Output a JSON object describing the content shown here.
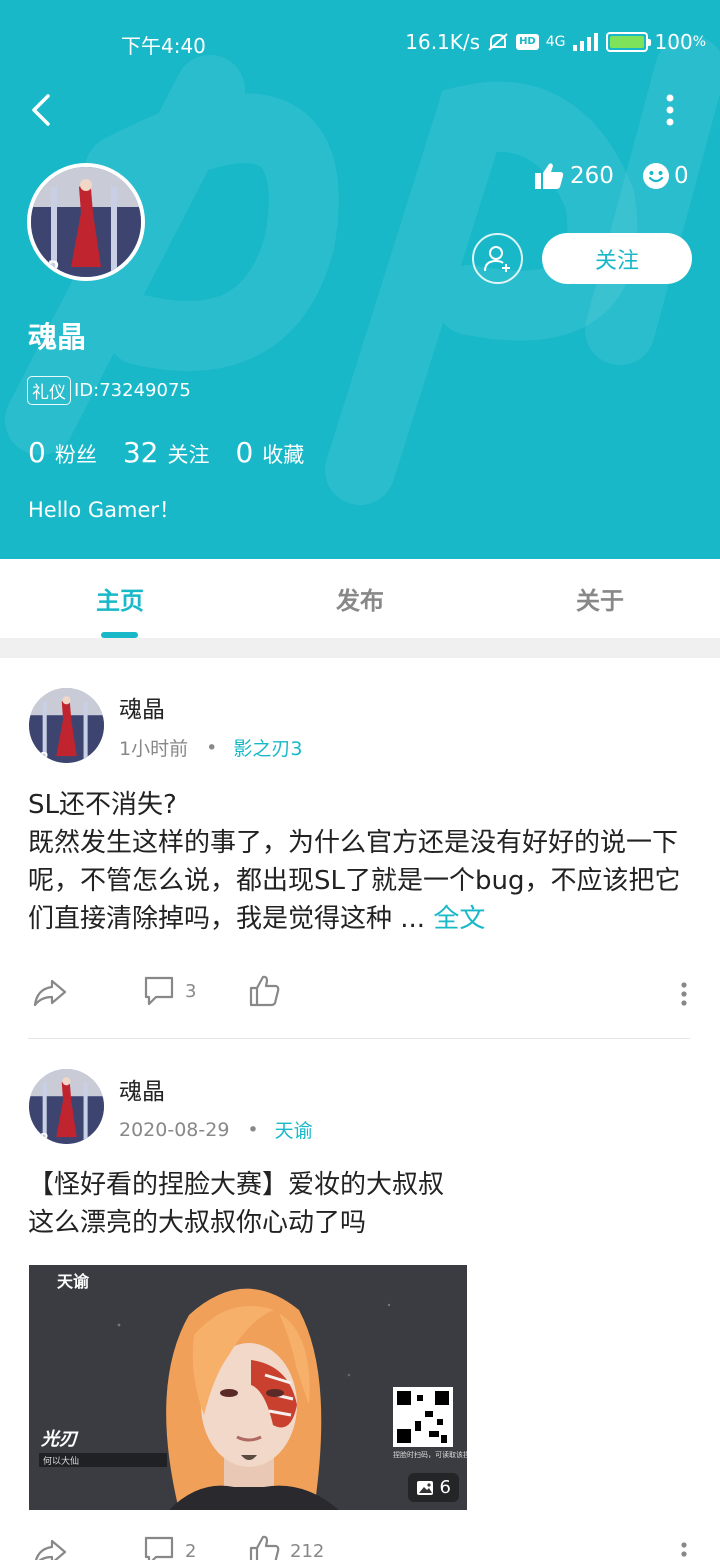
{
  "status_bar": {
    "time": "下午4:40",
    "network_speed": "16.1K/s",
    "hd": "HD",
    "signal": "4G",
    "battery": "100",
    "battery_unit": "%"
  },
  "profile": {
    "username": "魂晶",
    "badge": "礼仪",
    "id": "ID:73249075",
    "likes": "260",
    "smiles": "0",
    "follow_label": "关注",
    "fans_count": "0",
    "fans_label": "粉丝",
    "following_count": "32",
    "following_label": "关注",
    "favorites_count": "0",
    "favorites_label": "收藏",
    "bio": "Hello Gamer！"
  },
  "tabs": [
    {
      "label": "主页",
      "active": true
    },
    {
      "label": "发布",
      "active": false
    },
    {
      "label": "关于",
      "active": false
    }
  ],
  "posts": [
    {
      "author": "魂晶",
      "time": "1小时前",
      "separator": "•",
      "game": "影之刃3",
      "title": "SL还不消失?",
      "body": "既然发生这样的事了，为什么官方还是没有好好的说一下呢，不管怎么说，都出现SL了就是一个bug，不应该把它们直接清除掉吗，我是觉得这种 ...",
      "more_label": "全文",
      "comments": "3",
      "likes": ""
    },
    {
      "author": "魂晶",
      "time": "2020-08-29",
      "separator": "•",
      "game": "天谕",
      "title": "【怪好看的捏脸大赛】爱妆的大叔叔",
      "body": "这么漂亮的大叔叔你心动了吗",
      "image_count": "6",
      "image_logo": "天谕",
      "image_caption": "何以大仙",
      "qr_caption": "捏脸时扫码，可读取该捏脸数据",
      "comments": "2",
      "likes": "212"
    }
  ],
  "colors": {
    "accent": "#18b8c9",
    "text": "#222222",
    "muted": "#888888"
  }
}
